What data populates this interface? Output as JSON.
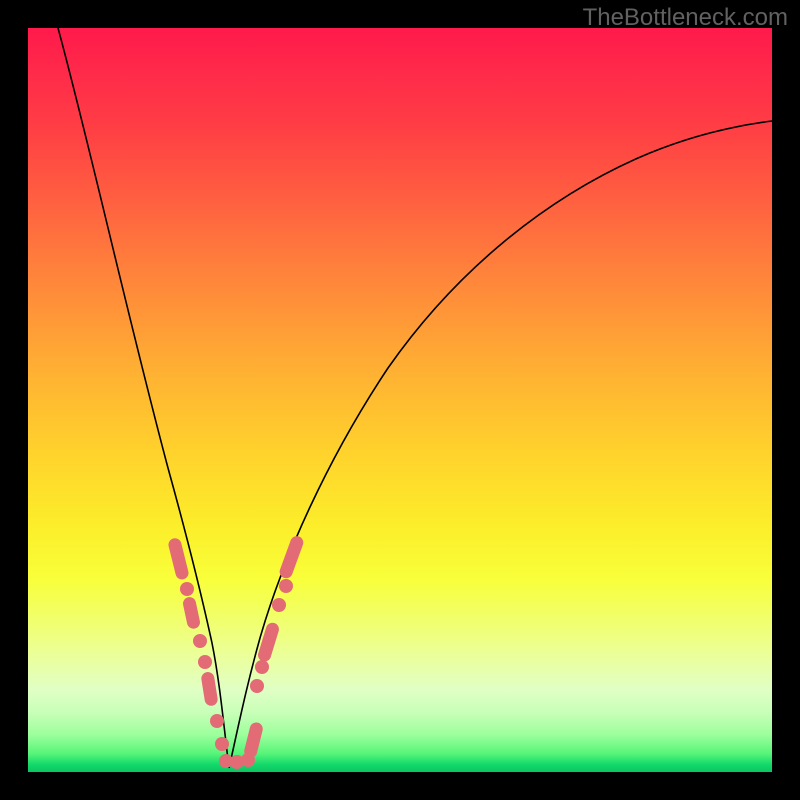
{
  "watermark": "TheBottleneck.com",
  "colors": {
    "frame": "#000000",
    "curve": "#000000",
    "marker": "#e36b75"
  },
  "chart_data": {
    "type": "line",
    "title": "",
    "xlabel": "",
    "ylabel": "",
    "xlim": [
      0,
      100
    ],
    "ylim": [
      0,
      100
    ],
    "grid": false,
    "legend": false,
    "series": [
      {
        "name": "left-branch",
        "x": [
          4,
          6,
          8,
          10,
          12,
          14,
          16,
          18,
          19.5,
          21,
          22,
          23,
          24,
          25,
          25.8,
          26.5,
          27
        ],
        "y": [
          100,
          90,
          80,
          70,
          61,
          52.5,
          44.5,
          37,
          31.5,
          26,
          21.5,
          17,
          12.5,
          8,
          4.5,
          2,
          0.5
        ]
      },
      {
        "name": "right-branch",
        "x": [
          27,
          28,
          29.5,
          31,
          33,
          36,
          40,
          45,
          52,
          60,
          70,
          80,
          90,
          100
        ],
        "y": [
          0.5,
          3,
          8,
          13,
          20,
          29,
          39,
          48.5,
          58,
          66,
          73.5,
          79.5,
          84,
          87.5
        ]
      }
    ],
    "markers": {
      "name": "highlighted-region",
      "approx_points": [
        {
          "x": 20.1,
          "y": 29.5
        },
        {
          "x": 20.7,
          "y": 27
        },
        {
          "x": 21.4,
          "y": 24.3
        },
        {
          "x": 22.2,
          "y": 21
        },
        {
          "x": 22.7,
          "y": 18.7
        },
        {
          "x": 23.5,
          "y": 15
        },
        {
          "x": 24.3,
          "y": 11.5
        },
        {
          "x": 25,
          "y": 8
        },
        {
          "x": 25.7,
          "y": 4.7
        },
        {
          "x": 26.5,
          "y": 1.5
        },
        {
          "x": 27.2,
          "y": 0.7
        },
        {
          "x": 28,
          "y": 1
        },
        {
          "x": 28.7,
          "y": 1.3
        },
        {
          "x": 29.5,
          "y": 1.5
        },
        {
          "x": 30.5,
          "y": 5
        },
        {
          "x": 30.9,
          "y": 11
        },
        {
          "x": 31.5,
          "y": 13.5
        },
        {
          "x": 32.1,
          "y": 16.5
        },
        {
          "x": 32.6,
          "y": 18.7
        },
        {
          "x": 33.5,
          "y": 21.5
        },
        {
          "x": 34.3,
          "y": 24
        },
        {
          "x": 35,
          "y": 26.3
        },
        {
          "x": 35.8,
          "y": 28.7
        },
        {
          "x": 36.4,
          "y": 30.5
        }
      ]
    }
  }
}
